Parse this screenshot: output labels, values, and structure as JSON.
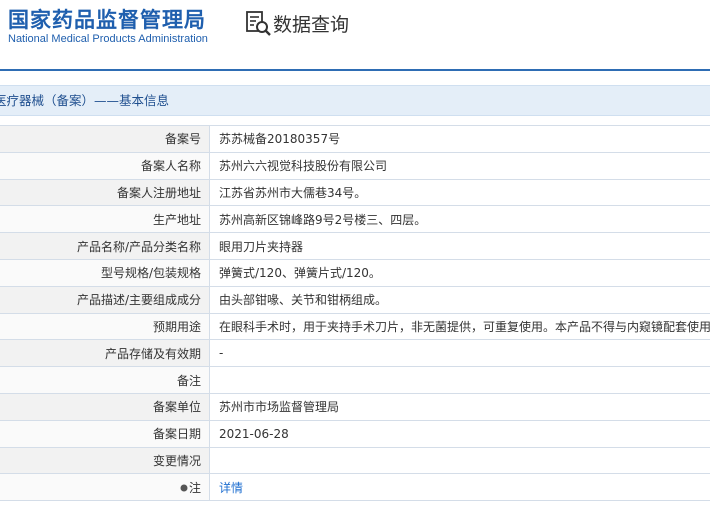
{
  "header": {
    "agency_cn": "国家药品监督管理局",
    "agency_en": "National Medical Products Administration",
    "query_label": "数据查询",
    "query_icon": "document-search-icon",
    "accent_color": "#1f5fae"
  },
  "section": {
    "title": "医疗器械（备案）——基本信息"
  },
  "rows": [
    {
      "label": "备案号",
      "value": "苏苏械备20180357号"
    },
    {
      "label": "备案人名称",
      "value": "苏州六六视觉科技股份有限公司"
    },
    {
      "label": "备案人注册地址",
      "value": "江苏省苏州市大儒巷34号。"
    },
    {
      "label": "生产地址",
      "value": "苏州高新区锦峰路9号2号楼三、四层。"
    },
    {
      "label": "产品名称/产品分类名称",
      "value": "眼用刀片夹持器"
    },
    {
      "label": "型号规格/包装规格",
      "value": "弹簧式/120、弹簧片式/120。"
    },
    {
      "label": "产品描述/主要组成成分",
      "value": "由头部钳喙、关节和钳柄组成。"
    },
    {
      "label": "预期用途",
      "value": "在眼科手术时，用于夹持手术刀片，非无菌提供，可重复使用。本产品不得与内窥镜配套使用。"
    },
    {
      "label": "产品存储及有效期",
      "value": "-"
    },
    {
      "label": "备注",
      "value": ""
    },
    {
      "label": "备案单位",
      "value": "苏州市市场监督管理局"
    },
    {
      "label": "备案日期",
      "value": "2021-06-28"
    },
    {
      "label": "变更情况",
      "value": ""
    }
  ],
  "note_row": {
    "label": "注",
    "link": "详情"
  }
}
